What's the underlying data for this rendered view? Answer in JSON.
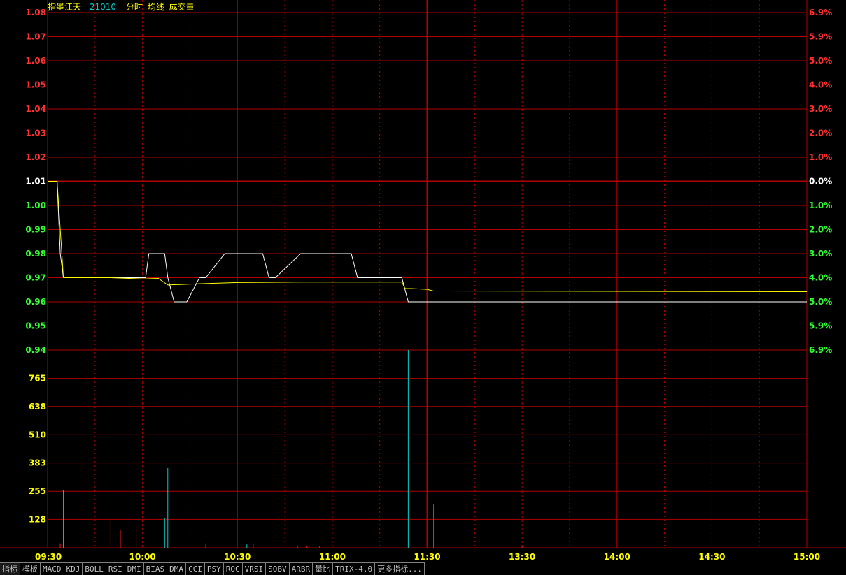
{
  "header": {
    "stock_name": "指墨江天",
    "stock_code": "21010",
    "labels": [
      "分时",
      "均线",
      "成交量"
    ]
  },
  "colors": {
    "grid": "#b00000",
    "axis_up": "#ff3030",
    "axis_down": "#30ff30",
    "axis_flat": "#ffffff",
    "price_line": "#ffffff",
    "avg_line": "#ffff00",
    "volume_up": "#ff2020",
    "volume_down": "#00d0d0",
    "time_label": "#ffff00",
    "volume_label": "#ffff00"
  },
  "price_axis": {
    "labels": [
      "1.08",
      "1.07",
      "1.06",
      "1.05",
      "1.04",
      "1.03",
      "1.02",
      "1.01",
      "1.00",
      "0.99",
      "0.98",
      "0.97",
      "0.96",
      "0.95",
      "0.94"
    ],
    "base": "1.01"
  },
  "percent_axis": {
    "labels": [
      "6.9%",
      "5.9%",
      "5.0%",
      "4.0%",
      "3.0%",
      "2.0%",
      "1.0%",
      "0.0%",
      "1.0%",
      "2.0%",
      "3.0%",
      "4.0%",
      "5.0%",
      "5.9%",
      "6.9%"
    ]
  },
  "volume_axis": {
    "labels": [
      "765",
      "638",
      "510",
      "383",
      "255",
      "128"
    ]
  },
  "time_axis": {
    "labels": [
      "09:30",
      "10:00",
      "10:30",
      "11:00",
      "11:30",
      "13:30",
      "14:00",
      "14:30",
      "15:00"
    ]
  },
  "chart_data": {
    "type": "line",
    "title": "",
    "x_unit": "minutes from 09:30 (trading time)",
    "ylim": [
      0.94,
      1.08
    ],
    "prev_close": 1.01,
    "series": [
      {
        "x": [
          0,
          3,
          4,
          5,
          30,
          31,
          32,
          36,
          37,
          38,
          40,
          44,
          48,
          50,
          56,
          59,
          60,
          68,
          70,
          72,
          80,
          82,
          84,
          96,
          98,
          100,
          110,
          112,
          114,
          115,
          116,
          120,
          240
        ],
        "y": [
          1.01,
          1.01,
          0.98,
          0.97,
          0.97,
          0.97,
          0.98,
          0.98,
          0.98,
          0.97,
          0.96,
          0.96,
          0.97,
          0.97,
          0.98,
          0.98,
          0.98,
          0.98,
          0.97,
          0.97,
          0.98,
          0.98,
          0.98,
          0.98,
          0.97,
          0.97,
          0.97,
          0.97,
          0.96,
          0.96,
          0.96,
          0.96,
          0.96
        ]
      },
      {
        "x": [
          0,
          3,
          5,
          20,
          30,
          35,
          38,
          48,
          60,
          80,
          100,
          112,
          113,
          115,
          120,
          122,
          240
        ],
        "y": [
          1.01,
          1.01,
          0.97,
          0.97,
          0.9695,
          0.9697,
          0.967,
          0.9675,
          0.968,
          0.9682,
          0.9682,
          0.9682,
          0.9655,
          0.9655,
          0.9652,
          0.9645,
          0.9642
        ]
      }
    ],
    "volume": {
      "ylim": [
        0,
        893
      ],
      "bars": [
        {
          "x": 4,
          "v": 20,
          "up": true
        },
        {
          "x": 5,
          "v": 260,
          "up": false
        },
        {
          "x": 20,
          "v": 125,
          "up": true
        },
        {
          "x": 23,
          "v": 80,
          "up": true
        },
        {
          "x": 28,
          "v": 105,
          "up": true
        },
        {
          "x": 37,
          "v": 135,
          "up": false
        },
        {
          "x": 38,
          "v": 360,
          "up": false
        },
        {
          "x": 50,
          "v": 20,
          "up": true
        },
        {
          "x": 63,
          "v": 15,
          "up": false
        },
        {
          "x": 65,
          "v": 20,
          "up": true
        },
        {
          "x": 79,
          "v": 10,
          "up": true
        },
        {
          "x": 82,
          "v": 10,
          "up": true
        },
        {
          "x": 86,
          "v": 8,
          "up": true
        },
        {
          "x": 114,
          "v": 893,
          "up": false
        },
        {
          "x": 122,
          "v": 195,
          "up": true
        },
        {
          "x": 150,
          "v": 8,
          "up": true
        }
      ]
    }
  },
  "tabs": [
    "指标",
    "模板",
    "MACD",
    "KDJ",
    "BOLL",
    "RSI",
    "DMI",
    "BIAS",
    "DMA",
    "CCI",
    "PSY",
    "ROC",
    "VRSI",
    "SOBV",
    "ARBR",
    "量比",
    "TRIX-4.0",
    "更多指标..."
  ]
}
